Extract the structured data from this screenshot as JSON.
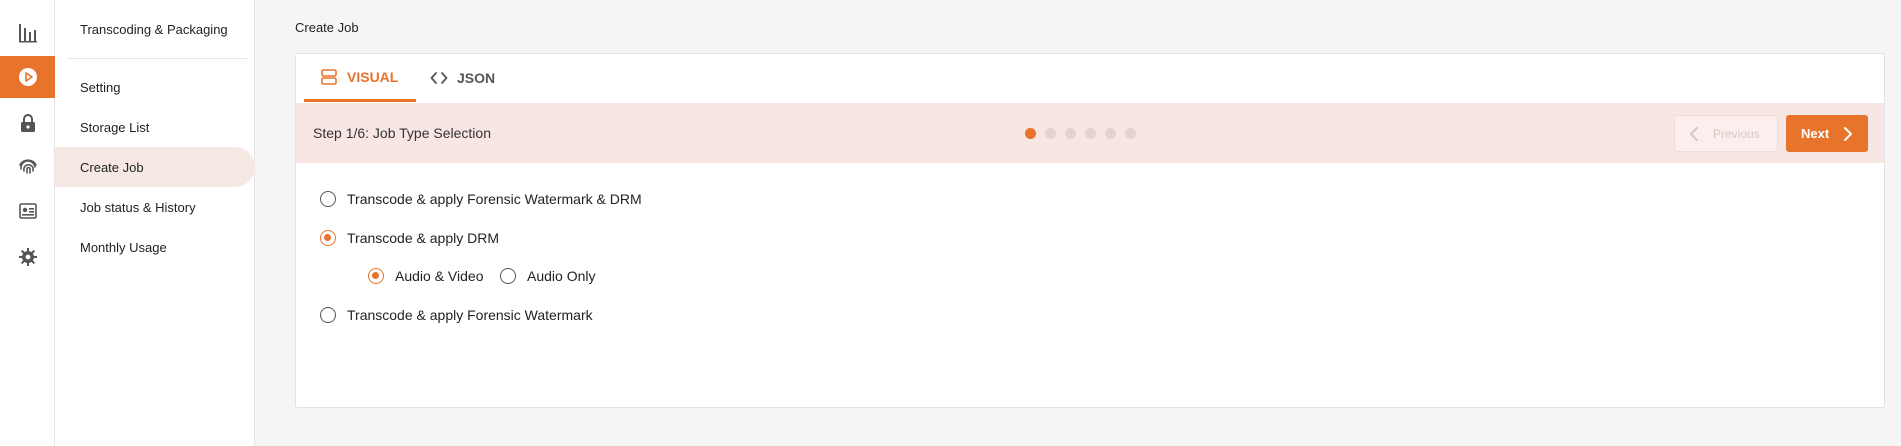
{
  "rail": {
    "items": [
      {
        "icon": "bar-chart-icon",
        "active": false
      },
      {
        "icon": "play-circle-icon",
        "active": true
      },
      {
        "icon": "lock-icon",
        "active": false
      },
      {
        "icon": "fingerprint-icon",
        "active": false
      },
      {
        "icon": "id-card-icon",
        "active": false
      },
      {
        "icon": "gear-icon",
        "active": false
      }
    ]
  },
  "subnav": {
    "title": "Transcoding & Packaging",
    "items": [
      {
        "label": "Setting"
      },
      {
        "label": "Storage List"
      },
      {
        "label": "Create Job",
        "active": true
      },
      {
        "label": "Job status & History"
      },
      {
        "label": "Monthly Usage"
      }
    ]
  },
  "page": {
    "title": "Create Job"
  },
  "tabs": {
    "visual": "VISUAL",
    "json": "JSON",
    "active": "visual"
  },
  "wizard": {
    "step_label": "Step 1/6: Job Type Selection",
    "current_step": 1,
    "total_steps": 6,
    "prev_label": "Previous",
    "next_label": "Next"
  },
  "options": {
    "opt1": "Transcode & apply Forensic Watermark & DRM",
    "opt2": "Transcode & apply DRM",
    "sub1": "Audio & Video",
    "sub2": "Audio Only",
    "opt3": "Transcode & apply Forensic Watermark",
    "selected": "opt2",
    "selected_sub": "sub1"
  },
  "colors": {
    "accent": "#e8732a",
    "stepbar": "#f8e6e4",
    "active_nav": "#f6e9e3"
  }
}
